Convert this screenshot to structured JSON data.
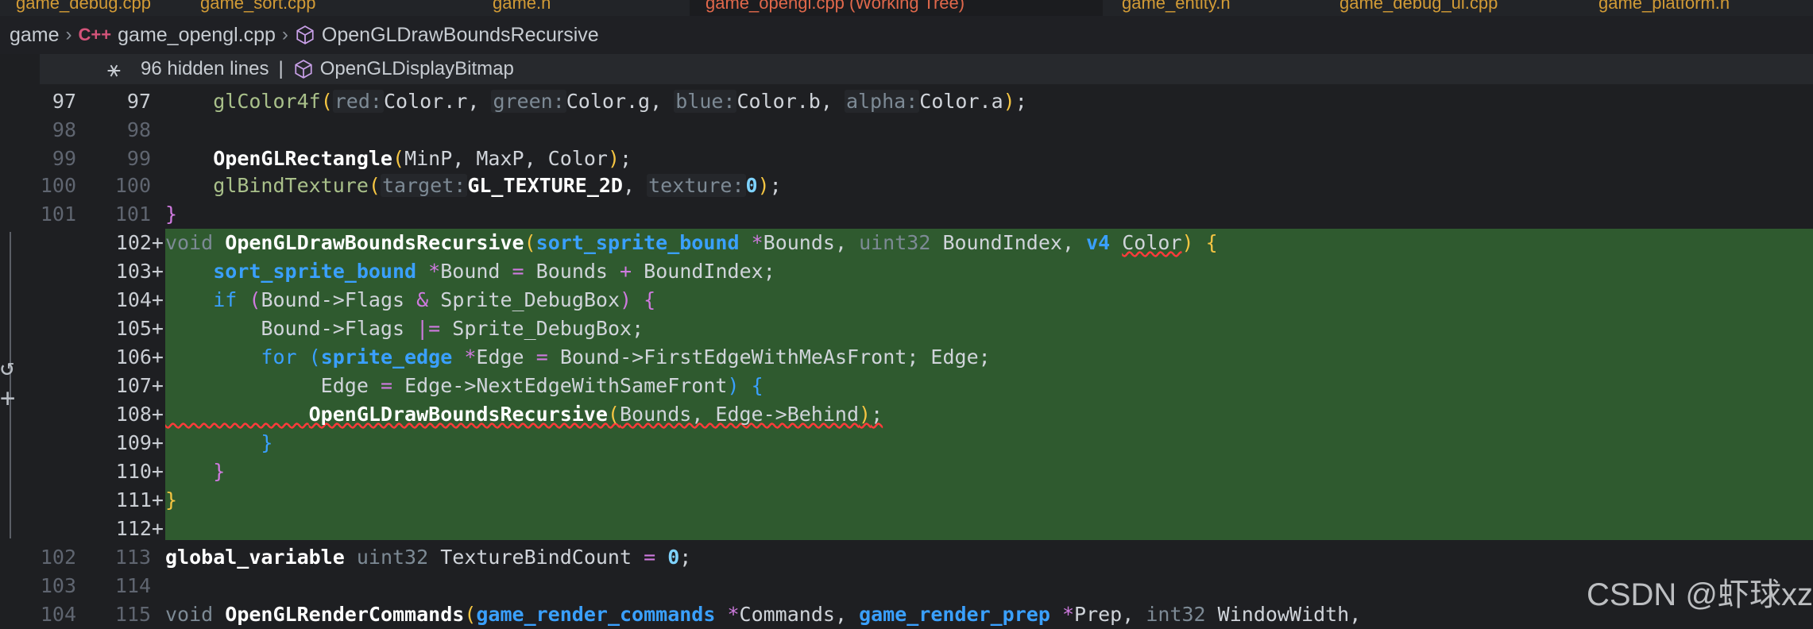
{
  "tabs": [
    {
      "label": "game_debug.cpp",
      "active": false
    },
    {
      "label": "game_sort.cpp",
      "active": false
    },
    {
      "label": "game.h",
      "active": false
    },
    {
      "label": "game_opengl.cpp (Working Tree)",
      "active": true
    },
    {
      "label": "game_entity.h",
      "active": false
    },
    {
      "label": "game_debug_ui.cpp",
      "active": false
    },
    {
      "label": "game_platform.h",
      "active": false
    }
  ],
  "breadcrumb": {
    "root": "game",
    "file": "game_opengl.cpp",
    "symbol": "OpenGLDrawBoundsRecursive"
  },
  "sticky": {
    "hidden": "96 hidden lines",
    "pipe": "|",
    "symbol": "OpenGLDisplayBitmap"
  },
  "lines": [
    {
      "old": "97",
      "new": "97",
      "added": false,
      "current": true
    },
    {
      "old": "98",
      "new": "98",
      "added": false
    },
    {
      "old": "99",
      "new": "99",
      "added": false
    },
    {
      "old": "100",
      "new": "100",
      "added": false
    },
    {
      "old": "101",
      "new": "101",
      "added": false
    },
    {
      "old": "",
      "new": "102+",
      "added": true
    },
    {
      "old": "",
      "new": "103+",
      "added": true
    },
    {
      "old": "",
      "new": "104+",
      "added": true
    },
    {
      "old": "",
      "new": "105+",
      "added": true
    },
    {
      "old": "",
      "new": "106+",
      "added": true
    },
    {
      "old": "",
      "new": "107+",
      "added": true
    },
    {
      "old": "",
      "new": "108+",
      "added": true
    },
    {
      "old": "",
      "new": "109+",
      "added": true
    },
    {
      "old": "",
      "new": "110+",
      "added": true
    },
    {
      "old": "",
      "new": "111+",
      "added": true
    },
    {
      "old": "",
      "new": "112+",
      "added": true
    },
    {
      "old": "102",
      "new": "113",
      "added": false
    },
    {
      "old": "103",
      "new": "114",
      "added": false
    },
    {
      "old": "104",
      "new": "115",
      "added": false
    }
  ],
  "code": {
    "l97": {
      "fn": "glColor4f",
      "h1": "red:",
      "a1": "Color.r",
      "h2": "green:",
      "a2": "Color.g",
      "h3": "blue:",
      "a3": "Color.b",
      "h4": "alpha:",
      "a4": "Color.a"
    },
    "l99": {
      "fn": "OpenGLRectangle",
      "args": "MinP, MaxP, Color"
    },
    "l100": {
      "fn": "glBindTexture",
      "h1": "target:",
      "c1": "GL_TEXTURE_2D",
      "h2": "texture:",
      "n2": "0"
    },
    "l102": {
      "kw": "void",
      "fn": "OpenGLDrawBoundsRecursive",
      "t1": "sort_sprite_bound",
      "p1": "Bounds",
      "t2": "uint32",
      "p2": "BoundIndex",
      "t3": "v4",
      "p3": "Color"
    },
    "l103": {
      "t": "sort_sprite_bound",
      "lhs": "Bound",
      "rhs1": "Bounds",
      "rhs2": "BoundIndex"
    },
    "l104": {
      "kw": "if",
      "a": "Bound->Flags",
      "b": "Sprite_DebugBox"
    },
    "l105": {
      "a": "Bound->Flags",
      "b": "Sprite_DebugBox"
    },
    "l106": {
      "kw": "for",
      "t": "sprite_edge",
      "v": "Edge",
      "rhs": "Bound->FirstEdgeWithMeAsFront",
      "cond": "Edge"
    },
    "l107": {
      "lhs": "Edge",
      "rhs": "Edge->NextEdgeWithSameFront"
    },
    "l108": {
      "fn": "OpenGLDrawBoundsRecursive",
      "args": "Bounds, Edge->Behind"
    },
    "l113": {
      "kw": "global_variable",
      "t": "uint32",
      "v": "TextureBindCount",
      "n": "0"
    },
    "l115": {
      "kw": "void",
      "fn": "OpenGLRenderCommands",
      "t1": "game_render_commands",
      "p1": "Commands",
      "t2": "game_render_prep",
      "p2": "Prep",
      "t3": "int32",
      "p3": "WindowWidth"
    }
  },
  "watermark": "CSDN @虾球xz",
  "colors": {
    "added_bg": "#2f5a2f",
    "editor_bg": "#1e1f22",
    "keyword": "#3aa0ff",
    "error": "#ff3b3b"
  }
}
